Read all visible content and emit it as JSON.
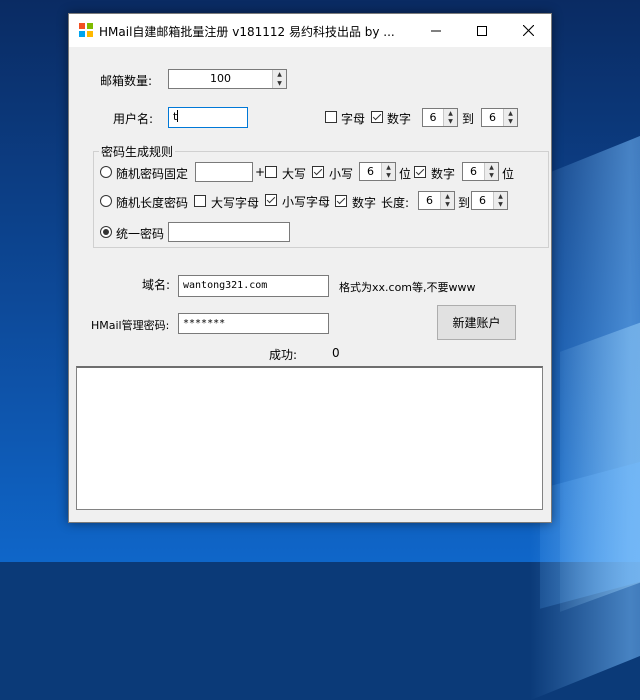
{
  "window": {
    "title": "HMail自建邮箱批量注册    v181112   易约科技出品   by ..."
  },
  "form": {
    "mailbox_count_label": "邮箱数量:",
    "mailbox_count_value": "100",
    "username_label": "用户名:",
    "username_value": "t",
    "letters_label": "字母",
    "letters_checked": false,
    "digits_label": "数字",
    "digits_checked": true,
    "digits_min": "6",
    "to_label": "到",
    "digits_max": "6"
  },
  "password_rules": {
    "group_title": "密码生成规则",
    "random_fixed": {
      "label": "随机密码固定",
      "selected": false,
      "length_value": "",
      "plus": "+",
      "upper_label": "大写",
      "upper_checked": false,
      "lower_label": "小写",
      "lower_checked": true,
      "lower_count": "6",
      "unit1": "位",
      "digit_label": "数字",
      "digit_checked": true,
      "digit_count": "6",
      "unit2": "位"
    },
    "random_length": {
      "label": "随机长度密码",
      "selected": false,
      "upper_label": "大写字母",
      "upper_checked": false,
      "lower_label": "小写字母",
      "lower_checked": true,
      "digit_label": "数字",
      "digit_checked": true,
      "length_label": "长度:",
      "length_min": "6",
      "to_label": "到",
      "length_max": "6"
    },
    "unified": {
      "label": "统一密码",
      "selected": true,
      "value": ""
    }
  },
  "domain": {
    "label": "域名:",
    "value": "wantong321.com",
    "hint": "格式为xx.com等,不要www"
  },
  "admin": {
    "label": "HMail管理密码:",
    "value": "*******"
  },
  "actions": {
    "create_label": "新建账户"
  },
  "status": {
    "success_label": "成功:",
    "success_count": "0"
  }
}
